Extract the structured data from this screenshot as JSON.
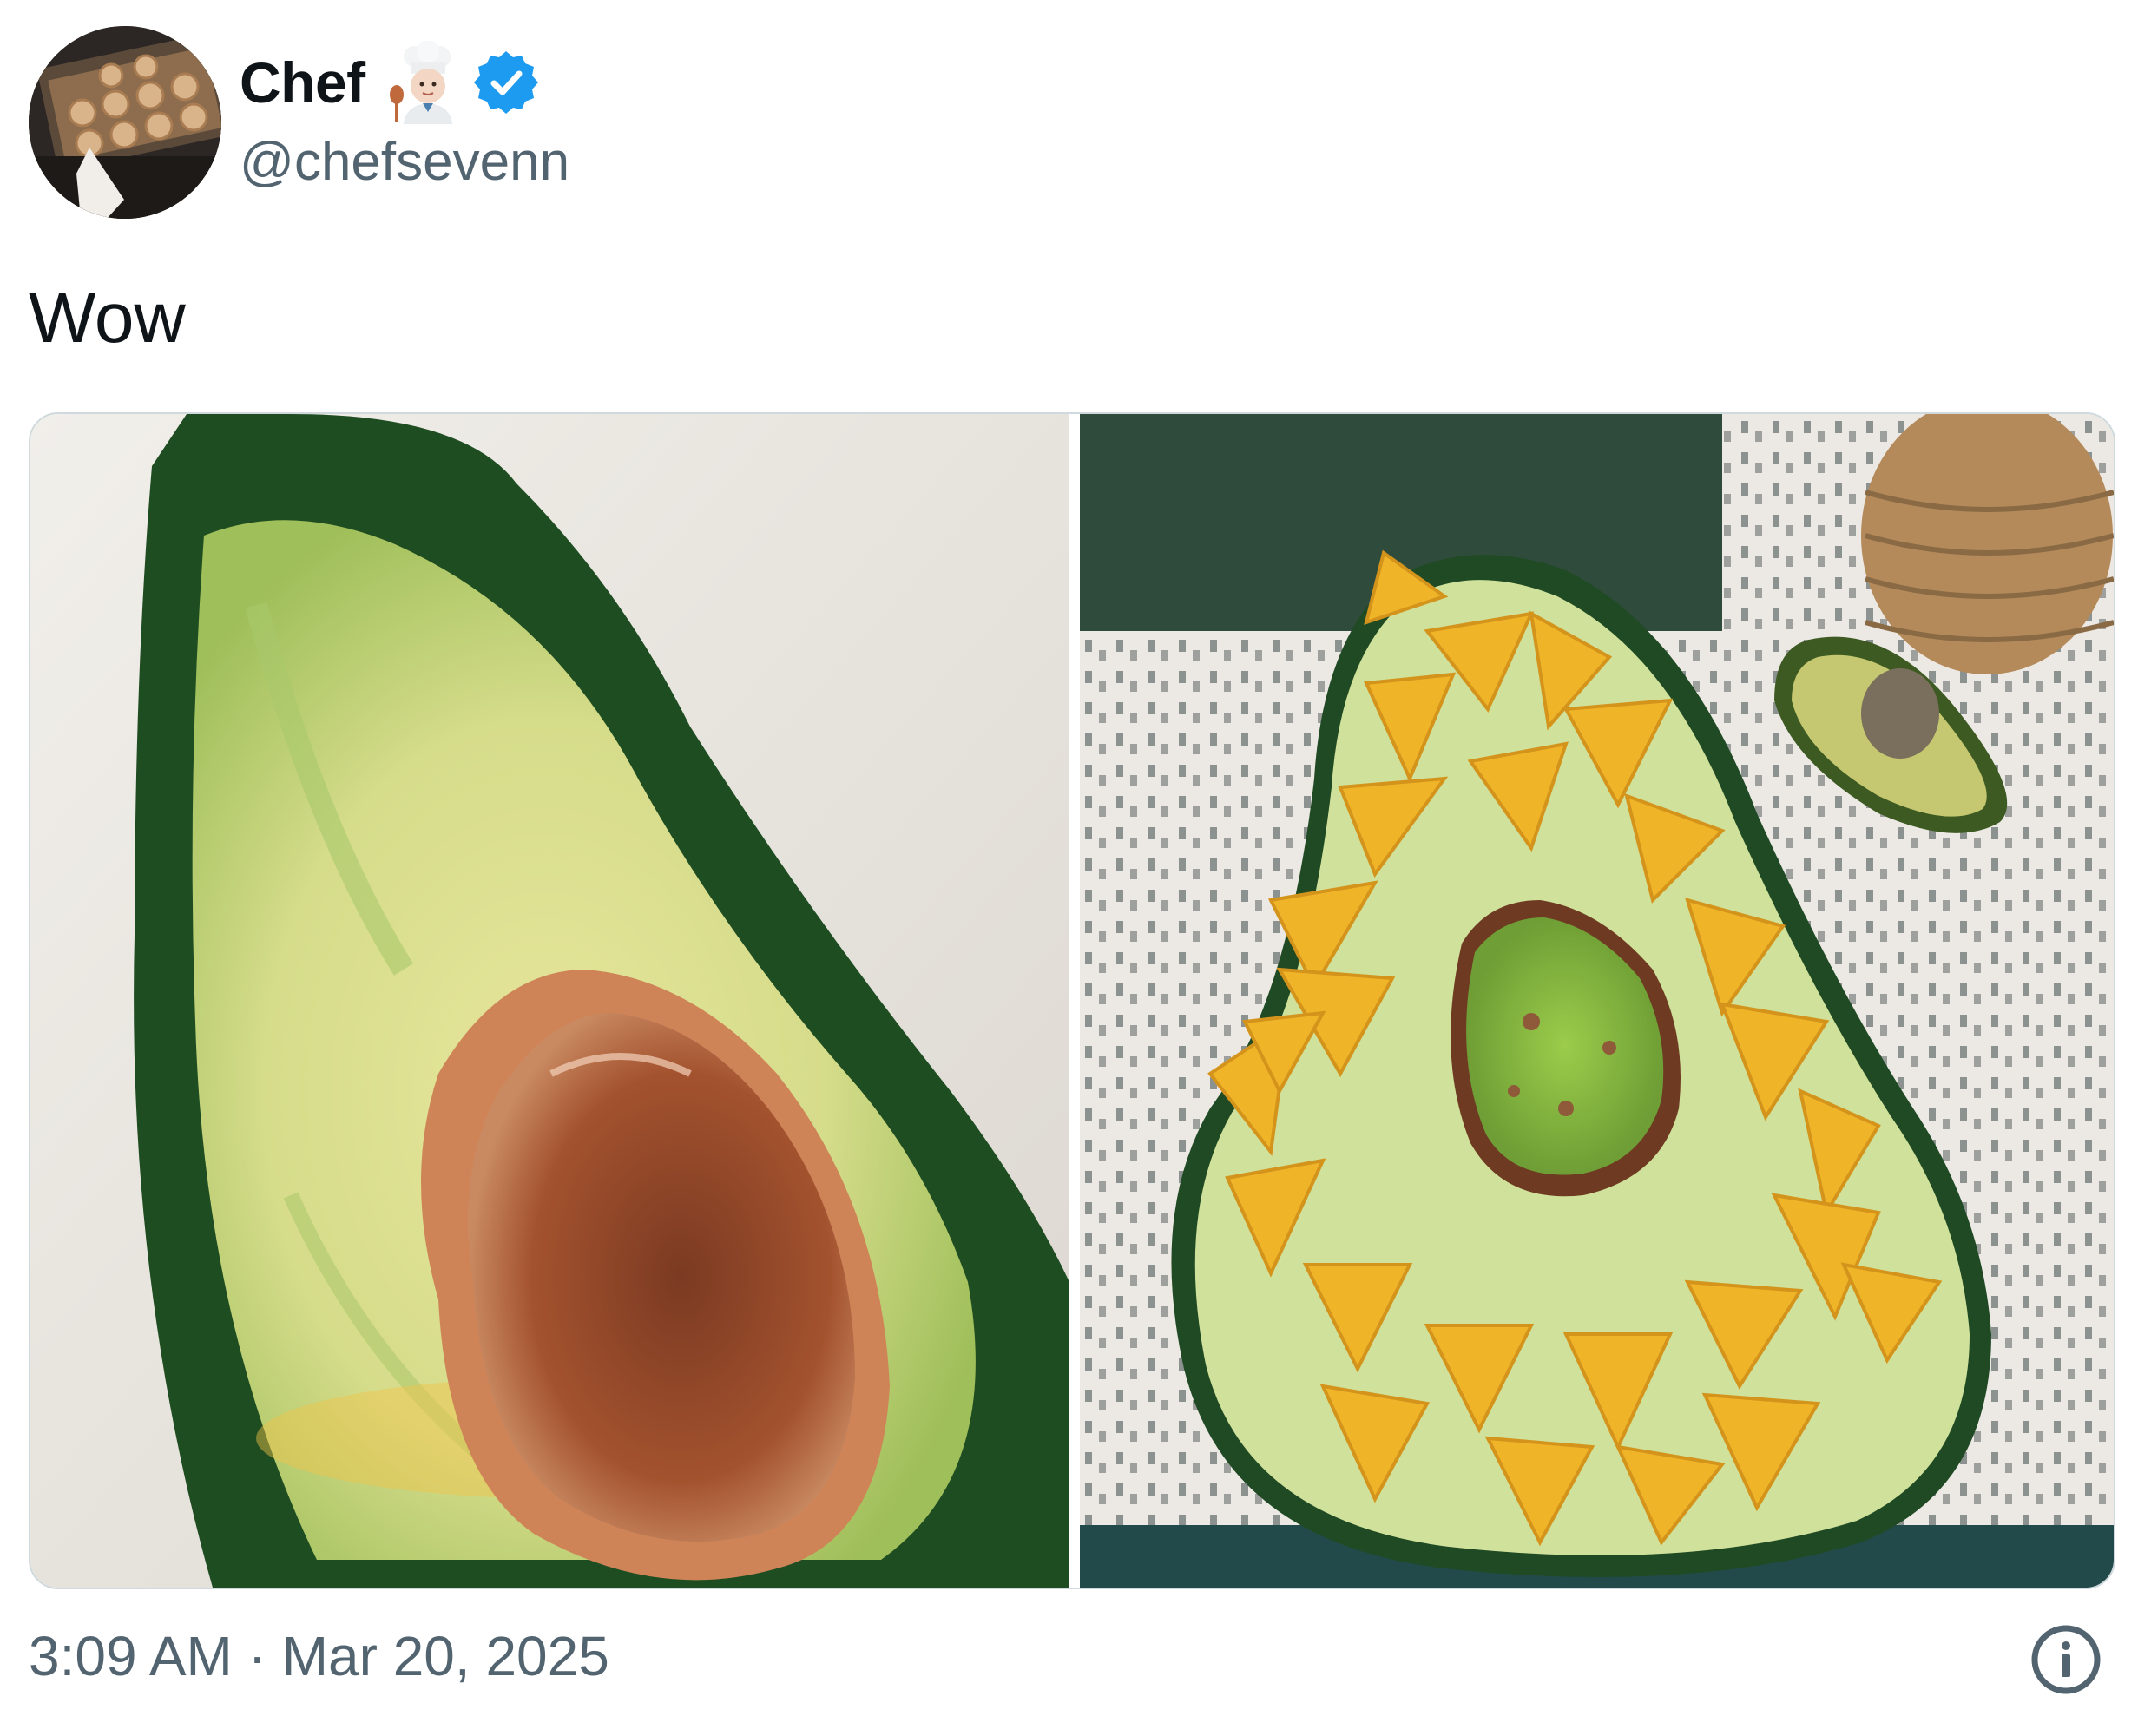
{
  "author": {
    "display_name": "Chef",
    "handle": "@chefsevenn",
    "emoji_icon": "cook-emoji-icon",
    "verified_icon": "verified-badge-icon"
  },
  "tweet": {
    "text": "Wow",
    "timestamp": "3:09 AM · Mar 20, 2025"
  },
  "media": {
    "photo_count": 2,
    "photos": [
      "avocado-shaped ceramic bowl",
      "avocado bowl with chips and guacamole"
    ]
  },
  "icons": {
    "info": "info-icon"
  },
  "colors": {
    "text_primary": "#0f1419",
    "text_secondary": "#536471",
    "verified_blue": "#1d9bf0",
    "border": "#cfd9de"
  }
}
